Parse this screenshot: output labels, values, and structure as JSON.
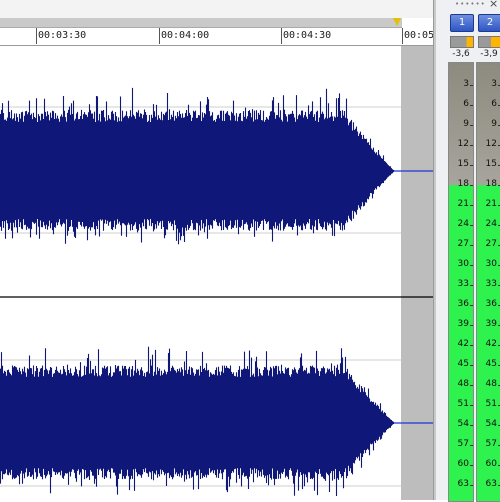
{
  "timeline": {
    "ticks": [
      "00:03:30",
      "00:04:00",
      "00:04:30",
      "00:05:"
    ]
  },
  "meters": {
    "channels": [
      "1",
      "2"
    ],
    "peaks": [
      "-3,6",
      "-3,9"
    ],
    "scale": [
      "3",
      "6",
      "9",
      "12",
      "15",
      "18",
      "21",
      "24",
      "27",
      "30",
      "33",
      "36",
      "39",
      "42",
      "45",
      "48",
      "51",
      "54",
      "57",
      "60",
      "63"
    ],
    "green_from_index": 5,
    "close_glyph": "×",
    "dots": "••••••"
  },
  "colors": {
    "waveform": "#0f1778",
    "cursor_line": "#1f35d6",
    "meter_green": "#2ef24e",
    "meter_gray": "#8a8a80",
    "peak_gray": "#9a9a9a",
    "peak_orange": "#ffb400",
    "selection_gray": "#bdbdbd"
  }
}
